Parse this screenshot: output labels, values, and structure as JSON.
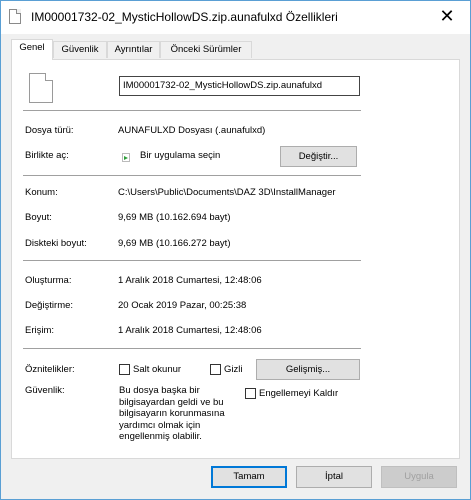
{
  "window": {
    "title": "IM00001732-02_MysticHollowDS.zip.aunafulxd Özellikleri",
    "close_symbol": "✕"
  },
  "tabs": [
    {
      "label": "Genel"
    },
    {
      "label": "Güvenlik"
    },
    {
      "label": "Ayrıntılar"
    },
    {
      "label": "Önceki Sürümler"
    }
  ],
  "general": {
    "file_name": "IM00001732-02_MysticHollowDS.zip.aunafulxd",
    "file_type_label": "Dosya türü:",
    "file_type_value": "AUNAFULXD Dosyası (.aunafulxd)",
    "opens_with_label": "Birlikte aç:",
    "opens_with_value": "Bir uygulama seçin",
    "change_button": "Değiştir...",
    "location_label": "Konum:",
    "location_value": "C:\\Users\\Public\\Documents\\DAZ 3D\\InstallManager",
    "size_label": "Boyut:",
    "size_value": "9,69 MB (10.162.694 bayt)",
    "size_on_disk_label": "Diskteki boyut:",
    "size_on_disk_value": "9,69 MB (10.166.272 bayt)",
    "created_label": "Oluşturma:",
    "created_value": "1 Aralık 2018 Cumartesi, 12:48:06",
    "modified_label": "Değiştirme:",
    "modified_value": "20 Ocak 2019 Pazar, 00:25:38",
    "accessed_label": "Erişim:",
    "accessed_value": "1 Aralık 2018 Cumartesi, 12:48:06",
    "attributes_label": "Öznitelikler:",
    "readonly_label": "Salt okunur",
    "hidden_label": "Gizli",
    "advanced_button": "Gelişmiş...",
    "security_label": "Güvenlik:",
    "security_text": "Bu dosya başka bir bilgisayardan geldi ve bu bilgisayarın korunmasına yardımcı olmak için engellenmiş olabilir.",
    "unblock_label": "Engellemeyi Kaldır"
  },
  "footer": {
    "ok": "Tamam",
    "cancel": "İptal",
    "apply": "Uygula"
  },
  "icons": {
    "file": "file-icon",
    "app": "app-chooser-icon",
    "close": "close-icon"
  },
  "colors": {
    "accent": "#0078d7",
    "window_border": "#5a9fd4"
  }
}
